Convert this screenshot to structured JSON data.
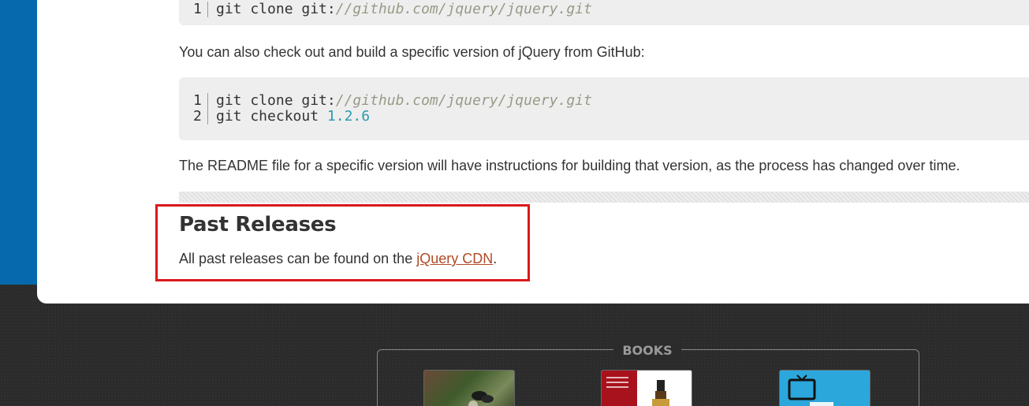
{
  "code_top": {
    "line_number": "1",
    "command": "git clone git:",
    "url": "//github.com/jquery/jquery.git"
  },
  "intro_text": "You can also check out and build a specific version of jQuery from GitHub:",
  "code_main": {
    "lines": [
      {
        "num": "1",
        "command": "git clone git:",
        "url": "//github.com/jquery/jquery.git"
      },
      {
        "num": "2",
        "command": "git checkout ",
        "version": "1.2.6"
      }
    ]
  },
  "readme_text": "The README file for a specific version will have instructions for building that version, as the process has changed over time.",
  "past_releases": {
    "heading": "Past Releases",
    "text_before": "All past releases can be found on the ",
    "link": "jQuery CDN",
    "text_after": "."
  },
  "footer": {
    "books_label": "BOOKS"
  },
  "colors": {
    "highlight_border": "#d9191d",
    "link": "#b24926",
    "brand_blue": "#0769ad"
  }
}
